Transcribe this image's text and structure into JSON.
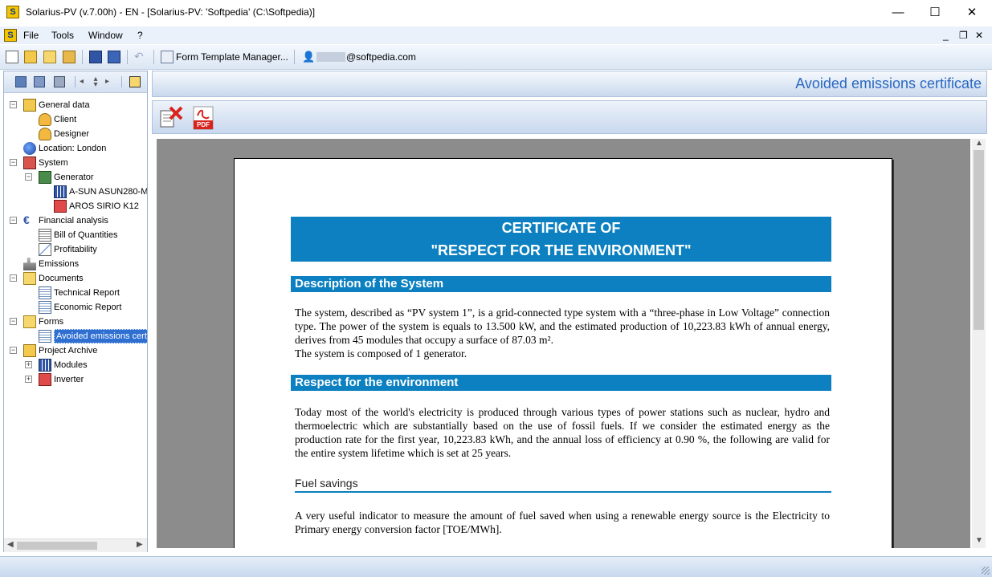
{
  "window": {
    "title": "Solarius-PV (v.7.00h) - EN - [Solarius-PV: 'Softpedia' (C:\\Softpedia)]",
    "minimize": "—",
    "maximize": "☐",
    "close": "✕"
  },
  "menu": {
    "items": [
      "File",
      "Tools",
      "Window",
      "?"
    ],
    "mdi_minimize": "_",
    "mdi_restore": "❐",
    "mdi_close": "✕"
  },
  "toolbar": {
    "form_template_manager": "Form Template Manager...",
    "user_email": "@softpedia.com"
  },
  "tree": {
    "items": [
      {
        "label": "General data"
      },
      {
        "label": "Client"
      },
      {
        "label": "Designer"
      },
      {
        "label": "Location: London"
      },
      {
        "label": "System"
      },
      {
        "label": "Generator"
      },
      {
        "label": "A-SUN ASUN280-M"
      },
      {
        "label": "AROS SIRIO K12"
      },
      {
        "label": "Financial analysis"
      },
      {
        "label": "Bill of Quantities"
      },
      {
        "label": "Profitability"
      },
      {
        "label": "Emissions"
      },
      {
        "label": "Documents"
      },
      {
        "label": "Technical Report"
      },
      {
        "label": "Economic Report"
      },
      {
        "label": "Forms"
      },
      {
        "label": "Avoided emissions certif"
      },
      {
        "label": "Project Archive"
      },
      {
        "label": "Modules"
      },
      {
        "label": "Inverter"
      }
    ]
  },
  "main": {
    "page_title": "Avoided emissions certificate",
    "pdf_label": "PDF"
  },
  "document": {
    "cert_line1": "CERTIFICATE OF",
    "cert_line2": "\"RESPECT FOR THE ENVIRONMENT\"",
    "section1_title": "Description of the System",
    "section1_text": "The system, described as “PV system 1”, is a grid-connected type system with a “three-phase in Low Voltage” connection type. The power of the system is equals to 13.500 kW, and the estimated production of 10,223.83 kWh of annual energy, derives from 45 modules that occupy a surface of 87.03 m².",
    "section1_text2": "The system is composed of 1 generator.",
    "section2_title": "Respect for the environment",
    "section2_text": "Today most of the world's electricity is produced through various types of power stations such as nuclear, hydro and thermoelectric which are substantially based on the use of fossil fuels. If we consider the estimated energy as the production rate for the first year, 10,223.83 kWh, and the annual loss of efficiency at 0.90 %, the following are valid for the entire system lifetime which is set at 25 years.",
    "sub_title": "Fuel savings",
    "sub_text": "A very useful indicator to measure the amount of fuel saved when using a renewable energy source is the Electricity to Primary energy conversion factor [TOE/MWh]."
  },
  "colors": {
    "accent": "#0c80c0",
    "selection": "#2e6fd1",
    "title_blue": "#2a68c2"
  }
}
